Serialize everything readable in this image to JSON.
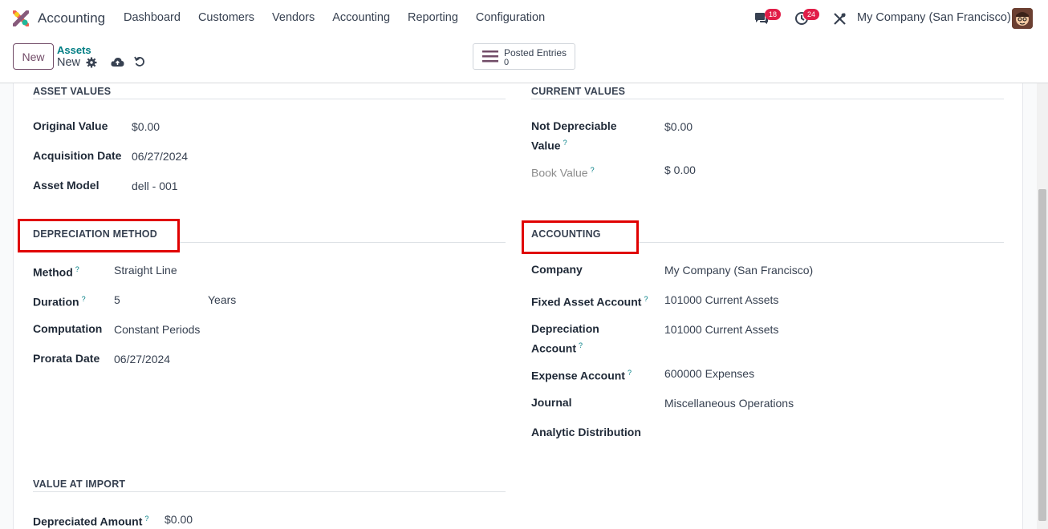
{
  "navbar": {
    "app_name": "Accounting",
    "menu": [
      "Dashboard",
      "Customers",
      "Vendors",
      "Accounting",
      "Reporting",
      "Configuration"
    ],
    "messages_badge": "18",
    "activities_badge": "24",
    "company": "My Company (San Francisco)"
  },
  "control": {
    "new_label": "New",
    "breadcrumb_parent": "Assets",
    "breadcrumb_current": "New",
    "smart_button": {
      "label": "Posted Entries",
      "value": "0"
    }
  },
  "asset_values": {
    "title": "ASSET VALUES",
    "fields": [
      {
        "label": "Original Value",
        "value": "$0.00"
      },
      {
        "label": "Acquisition Date",
        "value": "06/27/2024"
      },
      {
        "label": "Asset Model",
        "value": "dell - 001"
      }
    ]
  },
  "current_values": {
    "title": "CURRENT VALUES",
    "not_depreciable_label_1": "Not Depreciable",
    "not_depreciable_label_2": "Value",
    "not_depreciable_value": "$0.00",
    "book_value_label": "Book Value",
    "book_value": "$ 0.00"
  },
  "depreciation_method": {
    "title": "DEPRECIATION METHOD",
    "method_label": "Method",
    "method_value": "Straight Line",
    "duration_label": "Duration",
    "duration_value": "5",
    "duration_unit": "Years",
    "computation_label": "Computation",
    "computation_value": "Constant Periods",
    "prorata_label": "Prorata Date",
    "prorata_value": "06/27/2024"
  },
  "accounting": {
    "title": "ACCOUNTING",
    "company_label": "Company",
    "company_value": "My Company (San Francisco)",
    "fixed_asset_label": "Fixed Asset Account",
    "fixed_asset_value": "101000 Current Assets",
    "depreciation_label_1": "Depreciation",
    "depreciation_label_2": "Account",
    "depreciation_value": "101000 Current Assets",
    "expense_label": "Expense Account",
    "expense_value": "600000 Expenses",
    "journal_label": "Journal",
    "journal_value": "Miscellaneous Operations",
    "analytic_label": "Analytic Distribution"
  },
  "value_at_import": {
    "title": "VALUE AT IMPORT",
    "depreciated_label": "Depreciated Amount",
    "depreciated_value": "$0.00"
  },
  "help_mark": "?",
  "colors": {
    "brand": "#714b67",
    "link": "#017e84",
    "badge": "#e11d48",
    "highlight": "#e00000"
  }
}
